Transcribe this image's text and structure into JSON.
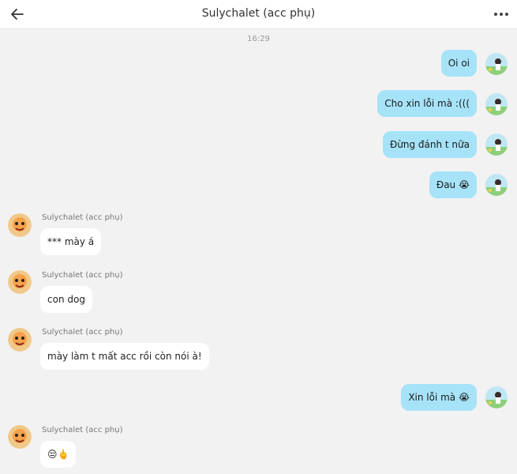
{
  "header": {
    "title": "Sulychalet (acc phụ)"
  },
  "timestamp": "16:29",
  "sender_name": "Sulychalet (acc phụ)",
  "outgoing": [
    {
      "text": "Oi oi"
    },
    {
      "text": "Cho xin lỗi mà :((("
    },
    {
      "text": "Đừng đánh t nữa"
    },
    {
      "text": "Đau 😭"
    },
    {
      "text": "Xin lỗi mà 😭"
    }
  ],
  "incoming": [
    {
      "sender": "Sulychalet (acc phụ)",
      "text": "*** mày á"
    },
    {
      "sender": "Sulychalet (acc phụ)",
      "text": "con dog"
    },
    {
      "sender": "Sulychalet (acc phụ)",
      "text": "mày làm t mất acc rồi còn nói à!"
    },
    {
      "sender": "Sulychalet (acc phụ)",
      "text": "😒🖕"
    }
  ],
  "colors": {
    "outgoing_bubble": "#a6e3f8",
    "incoming_bubble": "#ffffff",
    "background": "#f2f2f2"
  },
  "icons": {
    "back": "arrow-left-icon",
    "more": "more-dots-icon"
  }
}
